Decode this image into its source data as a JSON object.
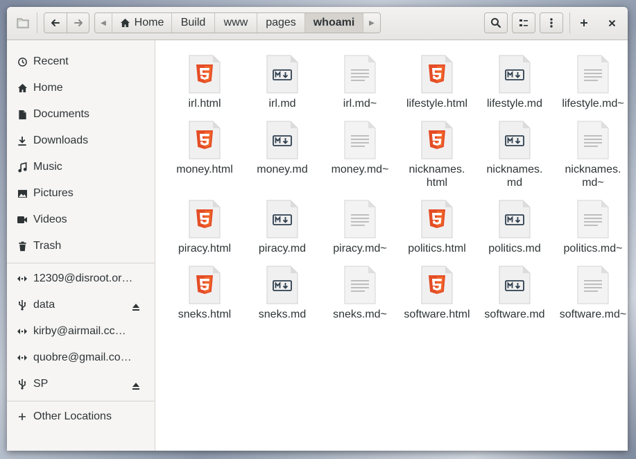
{
  "headerbar": {
    "home_crumb": "Home",
    "crumbs": [
      "Build",
      "www",
      "pages"
    ],
    "current": "whoami"
  },
  "sidebar": {
    "places": [
      {
        "label": "Recent",
        "icon": "clock-icon"
      },
      {
        "label": "Home",
        "icon": "home-icon"
      },
      {
        "label": "Documents",
        "icon": "document-icon"
      },
      {
        "label": "Downloads",
        "icon": "download-icon"
      },
      {
        "label": "Music",
        "icon": "music-icon"
      },
      {
        "label": "Pictures",
        "icon": "picture-icon"
      },
      {
        "label": "Videos",
        "icon": "video-icon"
      },
      {
        "label": "Trash",
        "icon": "trash-icon"
      }
    ],
    "devices": [
      {
        "label": "12309@disroot.or…",
        "icon": "network-icon",
        "eject": false
      },
      {
        "label": "data",
        "icon": "usb-icon",
        "eject": true
      },
      {
        "label": "kirby@airmail.cc@…",
        "icon": "network-icon",
        "eject": false
      },
      {
        "label": "quobre@gmail.co…",
        "icon": "network-icon",
        "eject": false
      },
      {
        "label": "SP",
        "icon": "usb-icon",
        "eject": true
      }
    ],
    "other_locations": "Other Locations"
  },
  "files": [
    {
      "name": "irl.html",
      "type": "html"
    },
    {
      "name": "irl.md",
      "type": "md"
    },
    {
      "name": "irl.md~",
      "type": "text"
    },
    {
      "name": "lifestyle.html",
      "type": "html"
    },
    {
      "name": "lifestyle.md",
      "type": "md"
    },
    {
      "name": "lifestyle.md~",
      "type": "text"
    },
    {
      "name": "money.html",
      "type": "html"
    },
    {
      "name": "money.md",
      "type": "md"
    },
    {
      "name": "money.md~",
      "type": "text"
    },
    {
      "name": "nicknames.\nhtml",
      "type": "html"
    },
    {
      "name": "nicknames.\nmd",
      "type": "md"
    },
    {
      "name": "nicknames.\nmd~",
      "type": "text"
    },
    {
      "name": "piracy.html",
      "type": "html"
    },
    {
      "name": "piracy.md",
      "type": "md"
    },
    {
      "name": "piracy.md~",
      "type": "text"
    },
    {
      "name": "politics.html",
      "type": "html"
    },
    {
      "name": "politics.md",
      "type": "md"
    },
    {
      "name": "politics.md~",
      "type": "text"
    },
    {
      "name": "sneks.html",
      "type": "html"
    },
    {
      "name": "sneks.md",
      "type": "md"
    },
    {
      "name": "sneks.md~",
      "type": "text"
    },
    {
      "name": "software.html",
      "type": "html"
    },
    {
      "name": "software.md",
      "type": "md"
    },
    {
      "name": "software.md~",
      "type": "text"
    }
  ]
}
